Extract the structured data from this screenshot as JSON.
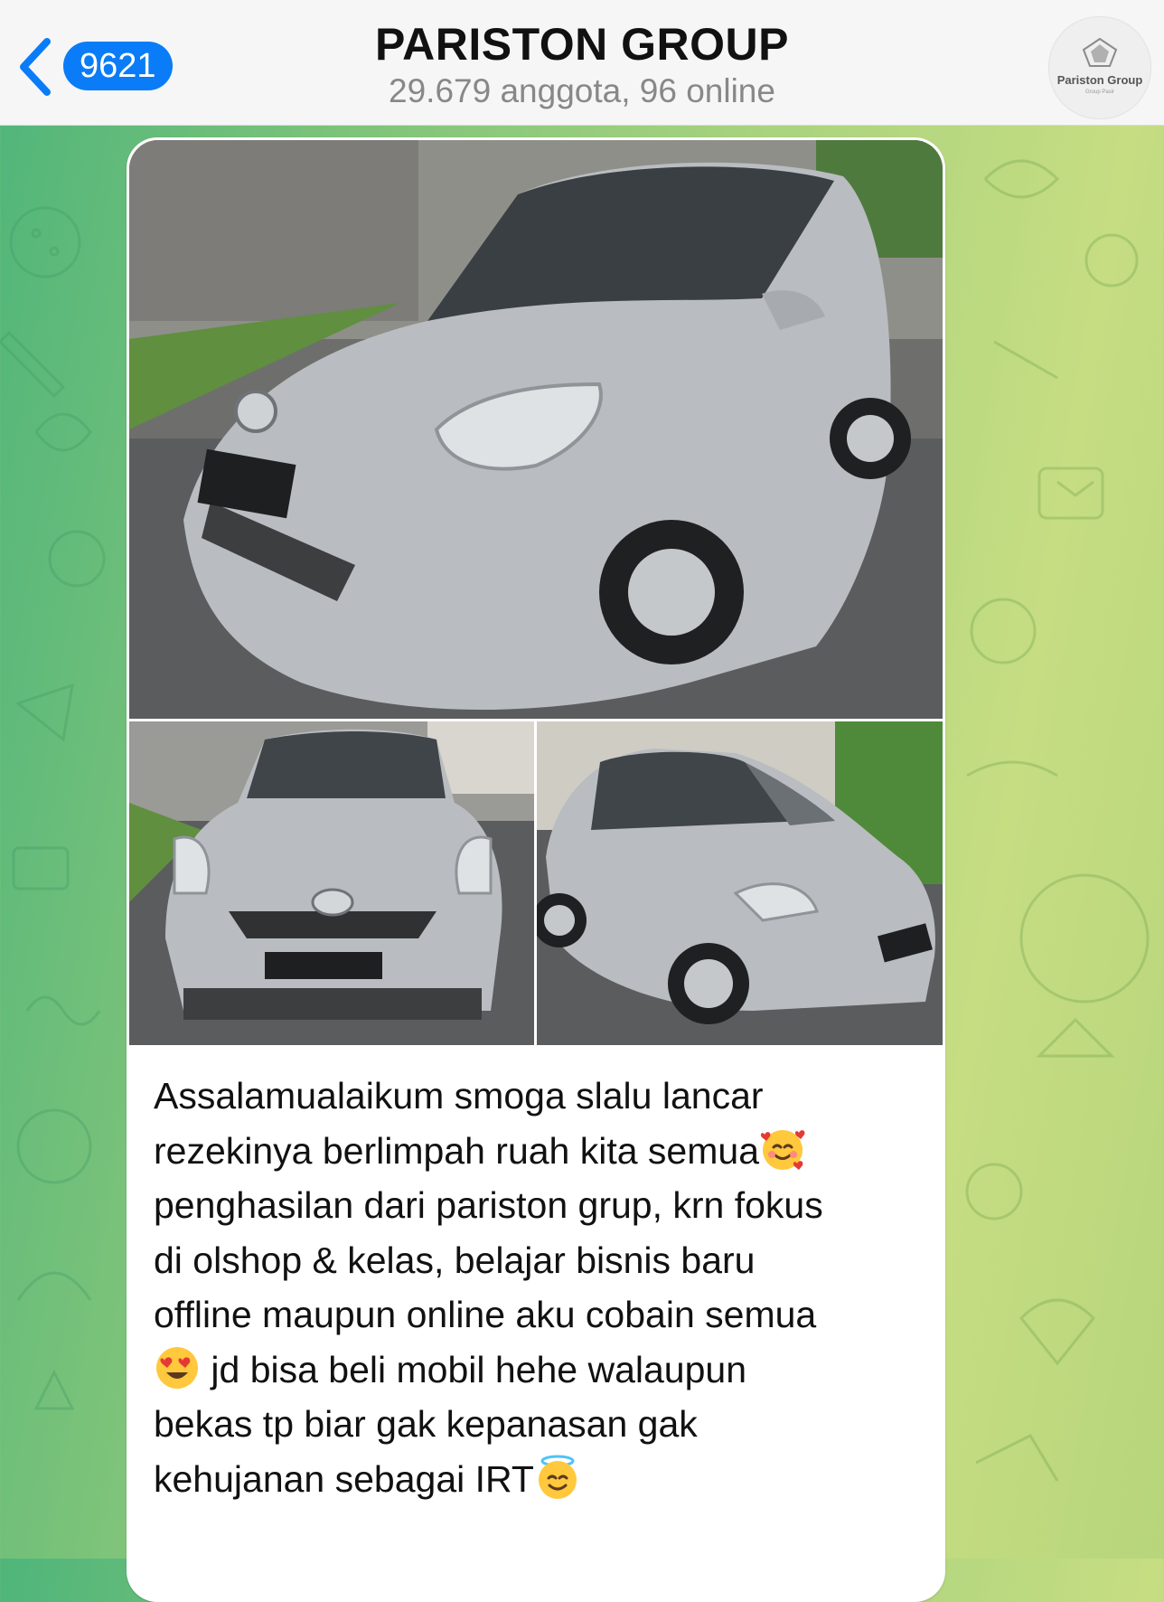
{
  "header": {
    "back_badge": "9621",
    "title": "PARISTON GROUP",
    "subtitle": "29.679 anggota, 96 online",
    "avatar_brand": "Pariston Group",
    "avatar_sub": "Group Pasir"
  },
  "message": {
    "photos": [
      {
        "subject": "silver hatchback car, front-right three-quarter view"
      },
      {
        "subject": "silver hatchback car, front view"
      },
      {
        "subject": "silver hatchback car, front-left three-quarter view"
      }
    ],
    "caption_lines": [
      "Assalamualaikum smoga slalu lancar",
      "rezekinya berlimpah ruah kita semua",
      "penghasilan dari pariston grup, krn fokus",
      "di olshop & kelas, belajar bisnis baru",
      "offline maupun online aku cobain semua",
      " jd bisa beli mobil hehe walaupun",
      "bekas tp biar gak kepanasan gak",
      "kehujanan sebagai IRT"
    ],
    "emojis": [
      "smiling-face-with-hearts",
      "heart-eyes",
      "smiling-face-with-halo"
    ]
  },
  "colors": {
    "accent": "#0a7cf7",
    "header_bg": "#f6f6f6",
    "bubble_bg": "#ffffff",
    "car_silver": "#b9bcc0",
    "wallpaper_left": "#4fb57a",
    "wallpaper_right": "#c6dd82"
  }
}
